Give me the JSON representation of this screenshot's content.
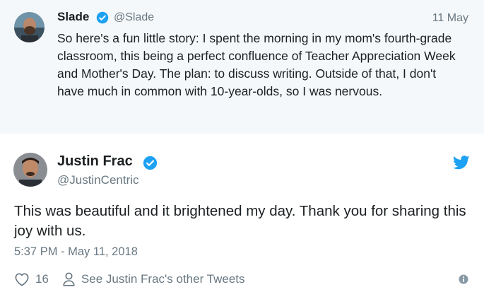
{
  "parent_tweet": {
    "name": "Slade",
    "handle": "@Slade",
    "date": "11 May",
    "text": "So here's a fun little story: I spent the morning in my mom's fourth-grade classroom, this being a perfect confluence of Teacher Appreciation Week and Mother's Day. The plan: to discuss writing. Outside of that, I don't have much in common with 10-year-olds, so I was nervous."
  },
  "tweet": {
    "name": "Justin Frac",
    "handle": "@JustinCentric",
    "text": "This was beautiful and it brightened my day. Thank you for sharing this joy with us.",
    "timestamp": "5:37 PM - May 11, 2018",
    "like_count": "16",
    "other_tweets_label": "See Justin Frac's other Tweets"
  },
  "colors": {
    "twitter_blue": "#1da1f2",
    "secondary_text": "#697882",
    "parent_background": "#f5f8fa"
  },
  "icons": {
    "verified": "verified-badge-icon",
    "bird": "twitter-bird-icon",
    "like": "heart-icon",
    "profile": "person-icon",
    "info": "info-icon"
  }
}
